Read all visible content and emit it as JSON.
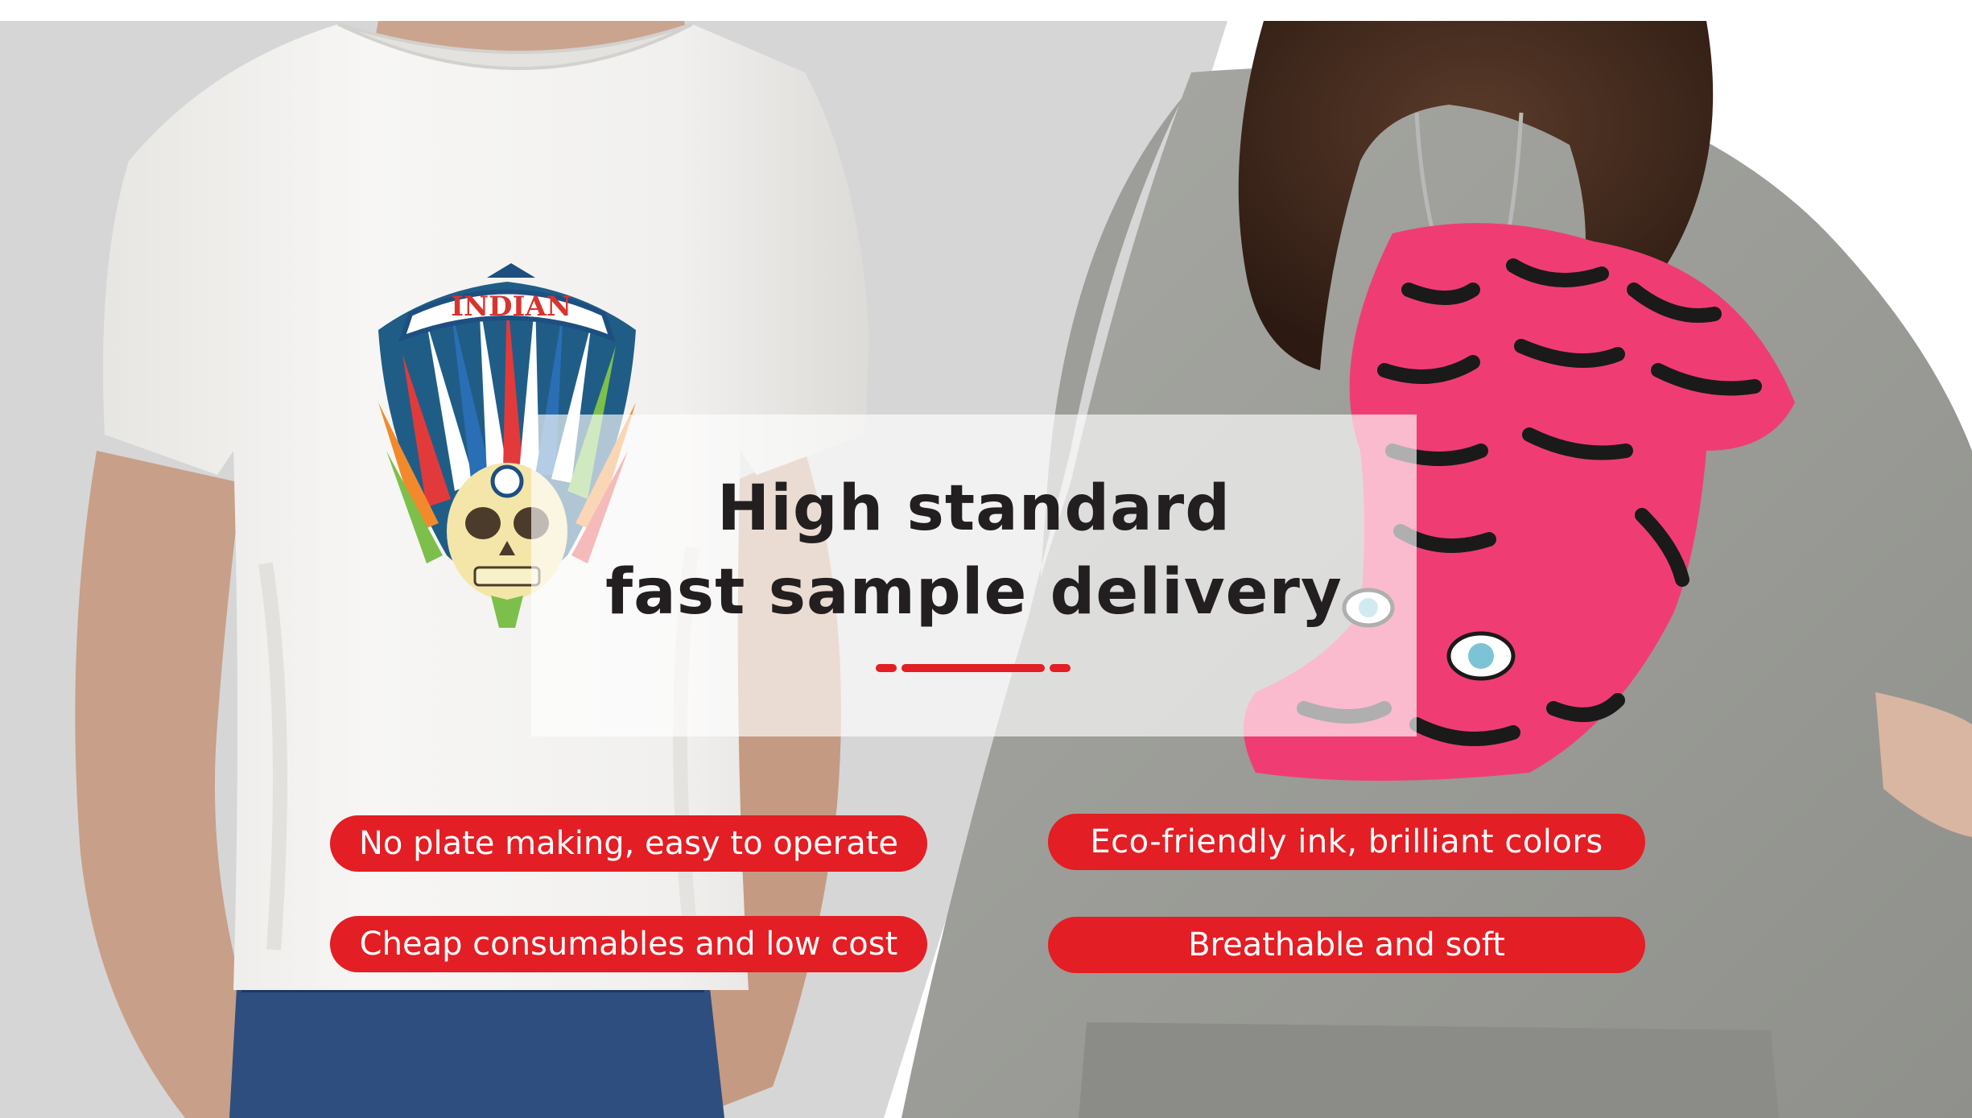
{
  "headline": {
    "line1": "High standard",
    "line2": "fast sample delivery"
  },
  "features": [
    "No plate making, easy to operate",
    "Eco-friendly ink, brilliant colors",
    "Cheap consumables and low cost",
    "Breathable and soft"
  ],
  "print_text": "INDIAN",
  "colors": {
    "accent": "#e31e24",
    "text_dark": "#231f20",
    "bg_gray": "#d6d6d6",
    "tee_white": "#f3f2f0",
    "sweater_gray": "#9b9c97",
    "tiger_pink": "#ef3d74"
  },
  "icons": [
    "skull-headdress-graphic",
    "tiger-graphic"
  ]
}
